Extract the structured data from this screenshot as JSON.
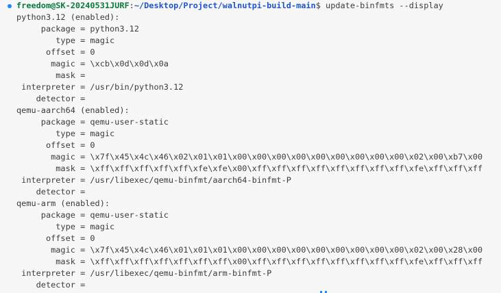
{
  "prompt": {
    "user_host": "freedom@SK-20240531JURF",
    "path": "~/Desktop/Project/walnutpi-build-main",
    "symbol": "$",
    "command": " update-binfmts --display",
    "marker_color": "#1a85ff"
  },
  "output_lines": [
    "python3.12 (enabled):",
    "     package = python3.12",
    "        type = magic",
    "      offset = 0",
    "       magic = \\xcb\\x0d\\x0d\\x0a",
    "        mask =",
    " interpreter = /usr/bin/python3.12",
    "    detector =",
    "qemu-aarch64 (enabled):",
    "     package = qemu-user-static",
    "        type = magic",
    "      offset = 0",
    "       magic = \\x7f\\x45\\x4c\\x46\\x02\\x01\\x01\\x00\\x00\\x00\\x00\\x00\\x00\\x00\\x00\\x00\\x02\\x00\\xb7\\x00",
    "        mask = \\xff\\xff\\xff\\xff\\xff\\xfe\\xfe\\x00\\xff\\xff\\xff\\xff\\xff\\xff\\xff\\xff\\xfe\\xff\\xff\\xff",
    " interpreter = /usr/libexec/qemu-binfmt/aarch64-binfmt-P",
    "    detector =",
    "qemu-arm (enabled):",
    "     package = qemu-user-static",
    "        type = magic",
    "      offset = 0",
    "       magic = \\x7f\\x45\\x4c\\x46\\x01\\x01\\x01\\x00\\x00\\x00\\x00\\x00\\x00\\x00\\x00\\x00\\x02\\x00\\x28\\x00",
    "        mask = \\xff\\xff\\xff\\xff\\xff\\xff\\xff\\x00\\xff\\xff\\xff\\xff\\xff\\xff\\xff\\xff\\xfe\\xff\\xff\\xff",
    " interpreter = /usr/libexec/qemu-binfmt/arm-binfmt-P",
    "    detector ="
  ]
}
